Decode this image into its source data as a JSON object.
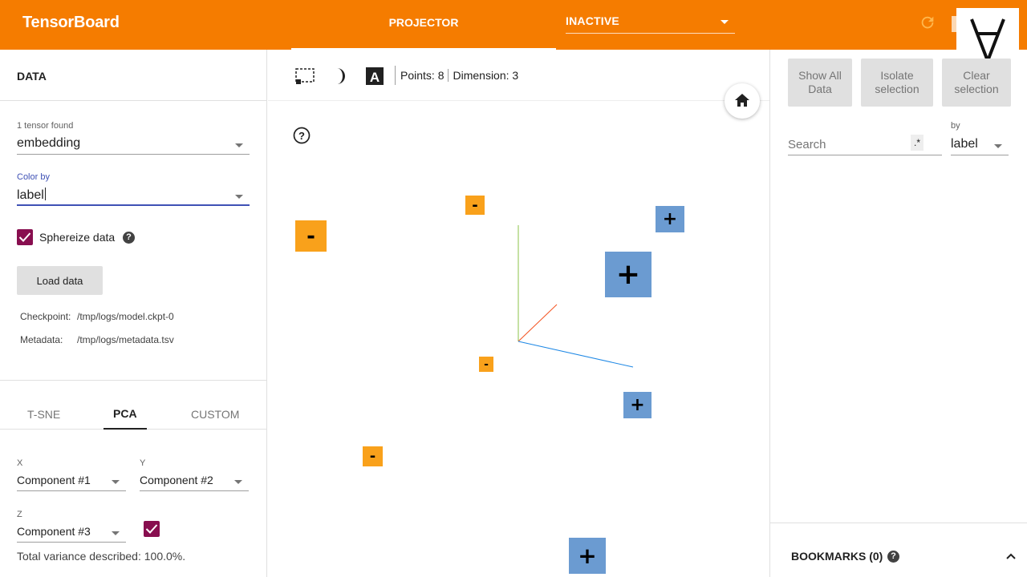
{
  "header": {
    "brand": "TensorBoard",
    "tab": "PROJECTOR",
    "run_select": "INACTIVE",
    "logo_glyph": "∀"
  },
  "data_panel": {
    "title": "DATA",
    "tensor_label": "1 tensor found",
    "tensor_value": "embedding",
    "color_by_label": "Color by",
    "color_by_value": "label",
    "sphereize_label": "Sphereize data",
    "sphereize_checked": true,
    "load_button": "Load data",
    "checkpoint_key": "Checkpoint:",
    "checkpoint_value": "/tmp/logs/model.ckpt-0",
    "metadata_key": "Metadata:",
    "metadata_value": "/tmp/logs/metadata.tsv"
  },
  "projection": {
    "tabs": [
      "T-SNE",
      "PCA",
      "CUSTOM"
    ],
    "selected_tab": "PCA",
    "x_label": "X",
    "x_value": "Component #1",
    "y_label": "Y",
    "y_value": "Component #2",
    "z_label": "Z",
    "z_value": "Component #3",
    "z_enabled": true,
    "variance": "Total variance described: 100.0%."
  },
  "toolbar": {
    "points": "Points: 8",
    "dimension": "Dimension: 3"
  },
  "scene": {
    "points": [
      {
        "label": "-",
        "class": "neg"
      },
      {
        "label": "-",
        "class": "neg"
      },
      {
        "label": "+",
        "class": "pos"
      },
      {
        "label": "+",
        "class": "pos"
      },
      {
        "label": "-",
        "class": "neg"
      },
      {
        "label": "+",
        "class": "pos"
      },
      {
        "label": "-",
        "class": "neg"
      },
      {
        "label": "+",
        "class": "pos"
      }
    ],
    "colors": {
      "negative": "#f9a11b",
      "positive": "#6b9bd1"
    }
  },
  "inspector": {
    "show_all": "Show All Data",
    "isolate": "Isolate selection",
    "clear": "Clear selection",
    "search_placeholder": "Search",
    "regex_glyph": ".*",
    "by_label": "by",
    "by_value": "label",
    "bookmarks": "BOOKMARKS (0)"
  },
  "colors": {
    "header": "#f57c00",
    "checkbox": "#880e4f",
    "active_underline": "#3f51b5"
  }
}
